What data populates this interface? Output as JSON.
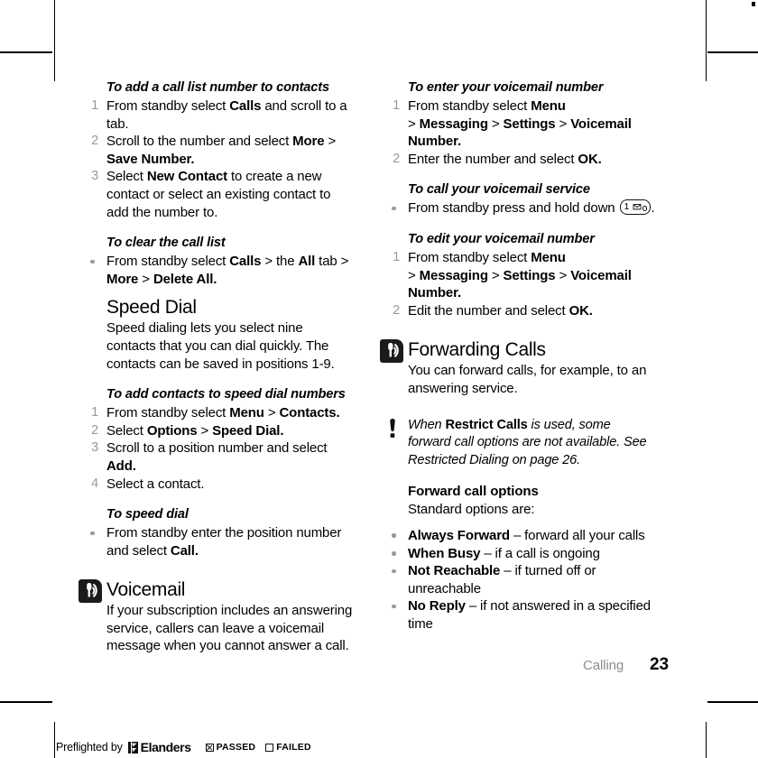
{
  "document": {
    "chapter_label": "Calling",
    "page_number": "23"
  },
  "left_column": {
    "proc_add_call_list": {
      "title": "To add a call list number to contacts",
      "steps": [
        {
          "num": "1",
          "html": "From standby select <b>Calls</b> and scroll to a tab."
        },
        {
          "num": "2",
          "html": "Scroll to the number and select <b>More</b> <span class=\"gt\">&gt;</span> <b>Save Number.</b>"
        },
        {
          "num": "3",
          "html": "Select <b>New Contact</b> to create a new contact or select an existing contact to add the number to."
        }
      ]
    },
    "proc_clear_call_list": {
      "title": "To clear the call list",
      "bullets": [
        {
          "html": "From standby select <b>Calls</b> <span class=\"gt\">&gt;</span> the <b>All</b> tab <span class=\"gt\">&gt;</span> <b>More</b> <span class=\"gt\">&gt;</span> <b>Delete All.</b>"
        }
      ]
    },
    "speed_dial": {
      "heading": "Speed Dial",
      "icon": "none",
      "body": "Speed dialing lets you select nine contacts that you can dial quickly. The contacts can be saved in positions 1-9."
    },
    "proc_add_speed_dial": {
      "title": "To add contacts to speed dial numbers",
      "steps": [
        {
          "num": "1",
          "html": "From standby select <b>Menu</b> <span class=\"gt\">&gt;</span> <b>Contacts.</b>"
        },
        {
          "num": "2",
          "html": "Select <b>Options</b> <span class=\"gt\">&gt;</span> <b>Speed Dial.</b>"
        },
        {
          "num": "3",
          "html": "Scroll to a position number and select <b>Add.</b>"
        },
        {
          "num": "4",
          "html": "Select a contact."
        }
      ]
    },
    "proc_speed_dial": {
      "title": "To speed dial",
      "bullets": [
        {
          "html": "From standby enter the position number and select <b>Call.</b>"
        }
      ]
    },
    "voicemail": {
      "heading": "Voicemail",
      "icon": "voicemail-signal-icon",
      "body": "If your subscription includes an answering service, callers can leave a voicemail message when you cannot answer a call."
    }
  },
  "right_column": {
    "proc_enter_voicemail": {
      "title": "To enter your voicemail number",
      "steps": [
        {
          "num": "1",
          "html": "From standby select <b>Menu</b><br><span class=\"gt\">&gt;</span> <b>Messaging</b> <span class=\"gt\">&gt;</span> <b>Settings</b> <span class=\"gt\">&gt;</span> <b>Voicemail Number.</b>"
        },
        {
          "num": "2",
          "html": "Enter the number and select <b>OK.</b>"
        }
      ]
    },
    "proc_call_voicemail": {
      "title": "To call your voicemail service",
      "bullets": [
        {
          "html": "From standby press and hold down <span class=\"keycap\" data-name=\"key-1-voicemail-icon\"><span class=\"k-num\">1</span><svg class=\"k-env\" viewBox=\"0 0 10 7\"><path d=\"M0.7 0.7 L9.3 0.7 L9.3 6.3 L0.7 6.3 Z\" fill=\"none\" stroke=\"#111\" stroke-width=\"1\"/><path d=\"M0.9 0.9 L5 4 L9.1 0.9\" fill=\"none\" stroke=\"#111\" stroke-width=\"1\"/></svg><span class=\"k-dot\"></span></span>."
        }
      ]
    },
    "proc_edit_voicemail": {
      "title": "To edit your voicemail number",
      "steps": [
        {
          "num": "1",
          "html": "From standby select <b>Menu</b><br><span class=\"gt\">&gt;</span> <b>Messaging</b> <span class=\"gt\">&gt;</span> <b>Settings</b> <span class=\"gt\">&gt;</span> <b>Voicemail Number.</b>"
        },
        {
          "num": "2",
          "html": "Edit the number and select <b>OK.</b>"
        }
      ]
    },
    "forwarding_calls": {
      "heading": "Forwarding Calls",
      "icon": "voicemail-signal-icon",
      "body": "You can forward calls, for example, to an answering service."
    },
    "note": {
      "icon": "exclamation-icon",
      "html": "When <b>Restrict Calls</b> is used, some forward call options are not available. See Restricted Dialing on page 26."
    },
    "forward_call_options": {
      "heading": "Forward call options",
      "intro": "Standard options are:",
      "bullets": [
        {
          "html": "<b>Always Forward</b> &ndash; forward all your calls"
        },
        {
          "html": "<b>When Busy</b> &ndash; if a call is ongoing"
        },
        {
          "html": "<b>Not Reachable</b> &ndash; if turned off or unreachable"
        },
        {
          "html": "<b>No Reply</b> &ndash; if not answered in a specified time"
        }
      ]
    }
  },
  "preflight": {
    "label": "Preflighted by",
    "brand": "Elanders",
    "passed_label": "PASSED",
    "failed_label": "FAILED",
    "passed_checked": true,
    "failed_checked": false
  }
}
